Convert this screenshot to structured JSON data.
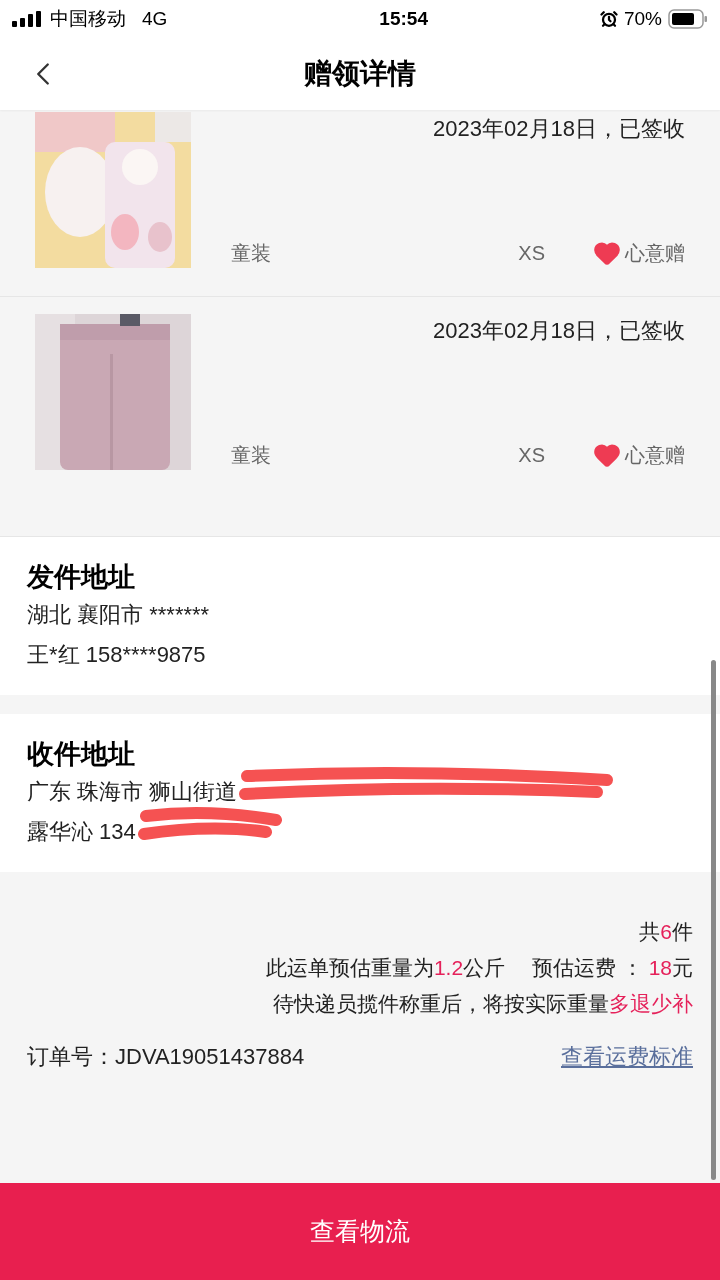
{
  "status_bar": {
    "carrier": "中国移动",
    "network": "4G",
    "time": "15:54",
    "battery": "70%"
  },
  "header": {
    "title": "赠领详情"
  },
  "items": [
    {
      "kind": "picture",
      "date": "2023年02月18日，已签收",
      "category": "童装",
      "size": "XS",
      "tag": "心意赠"
    },
    {
      "kind": "picture",
      "date": "2023年02月18日，已签收",
      "category": "童装",
      "size": "XS",
      "tag": "心意赠"
    }
  ],
  "sender": {
    "title": "发件地址",
    "address": "湖北 襄阳市 *******",
    "contact": "王*红 158****9875"
  },
  "receiver": {
    "title": "收件地址",
    "address": "广东 珠海市 狮山街道",
    "contact": "露华沁 134"
  },
  "summary": {
    "lines": [
      [
        {
          "text": "共",
          "highlight": false
        },
        {
          "text": "6",
          "highlight": true
        },
        {
          "text": "件",
          "highlight": false
        }
      ],
      [
        {
          "text": "此运单预估重量为",
          "highlight": false
        },
        {
          "text": "1.2",
          "highlight": true
        },
        {
          "text": "公斤　 预估运费 ： ",
          "highlight": false
        },
        {
          "text": "18",
          "highlight": true
        },
        {
          "text": "元",
          "highlight": false
        }
      ],
      [
        {
          "text": "待快递员揽件称重后，将按实际重量",
          "highlight": false
        },
        {
          "text": "多退少补",
          "highlight": true
        }
      ]
    ],
    "order_label": "订单号：",
    "order_number": "JDVA19051437884",
    "link": "查看运费标准"
  },
  "bottom_button": "查看物流"
}
